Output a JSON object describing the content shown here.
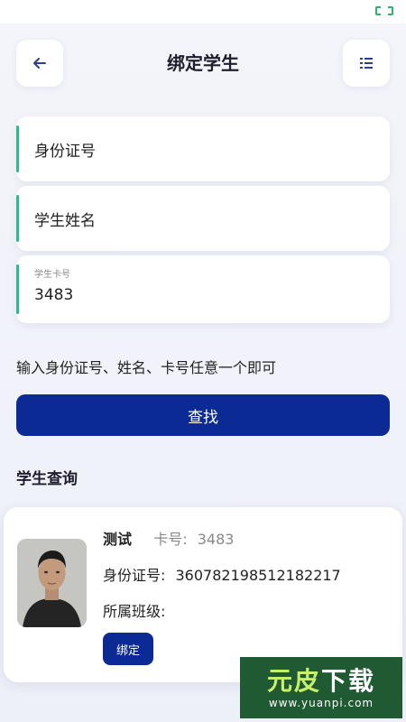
{
  "header": {
    "title": "绑定学生",
    "back_icon": "arrow-left-icon",
    "list_icon": "list-icon"
  },
  "form": {
    "id_number_placeholder": "身份证号",
    "name_placeholder": "学生姓名",
    "card_number_label": "学生卡号",
    "card_number_value": "3483",
    "accent_color": "#2fb98a"
  },
  "hint": "输入身份证号、姓名、卡号任意一个即可",
  "search_button": "查找",
  "section_title": "学生查询",
  "result": {
    "name": "测试",
    "card_label": "卡号:",
    "card_number": "3483",
    "id_label": "身份证号:",
    "id_number": "360782198512182217",
    "class_label": "所属班级:",
    "class_value": "",
    "bind_button": "绑定"
  },
  "watermark": {
    "text_part1": "元皮",
    "text_part2": "下载",
    "url": "www.yuanpi.com"
  },
  "colors": {
    "primary": "#0b2a94",
    "accent": "#2fb98a"
  }
}
